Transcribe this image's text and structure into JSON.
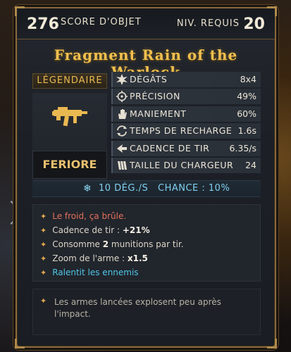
{
  "header": {
    "item_score": "276",
    "item_score_label": "SCORE D'OBJET",
    "level_required_label": "NIV. REQUIS",
    "level_required": "20"
  },
  "item": {
    "name": "Fragment Rain of the Warlock",
    "rarity": "LÉGENDAIRE",
    "brand": "FERIORE",
    "rarity_color": "#e9b850"
  },
  "stats": [
    {
      "icon": "damage-icon",
      "label": "DÉGÂTS",
      "value": "8x4"
    },
    {
      "icon": "accuracy-icon",
      "label": "PRÉCISION",
      "value": "49%"
    },
    {
      "icon": "handling-icon",
      "label": "MANIEMENT",
      "value": "60%"
    },
    {
      "icon": "reload-icon",
      "label": "TEMPS DE RECHARGE",
      "value": "1.6s"
    },
    {
      "icon": "fire-rate-icon",
      "label": "CADENCE DE TIR",
      "value": "6.35/s"
    },
    {
      "icon": "magazine-icon",
      "label": "TAILLE DU CHARGEUR",
      "value": "24"
    }
  ],
  "element": {
    "icon": "snowflake-icon",
    "damage": "10 DÉG./S",
    "chance": "CHANCE : 10%",
    "color": "#7fd0ef"
  },
  "perks": [
    {
      "text": "Le froid, ça brûle.",
      "style": "red"
    },
    {
      "pre": "Cadence de tir : ",
      "bold": "+21%",
      "post": ""
    },
    {
      "pre": "Consomme ",
      "bold": "2",
      "post": " munitions par tir."
    },
    {
      "pre": "Zoom de l'arme : ",
      "bold": "x1.5",
      "post": ""
    },
    {
      "text": "Ralentit les ennemis",
      "style": "cyan"
    }
  ],
  "flavor": "Les armes lancées explosent peu après l'impact."
}
